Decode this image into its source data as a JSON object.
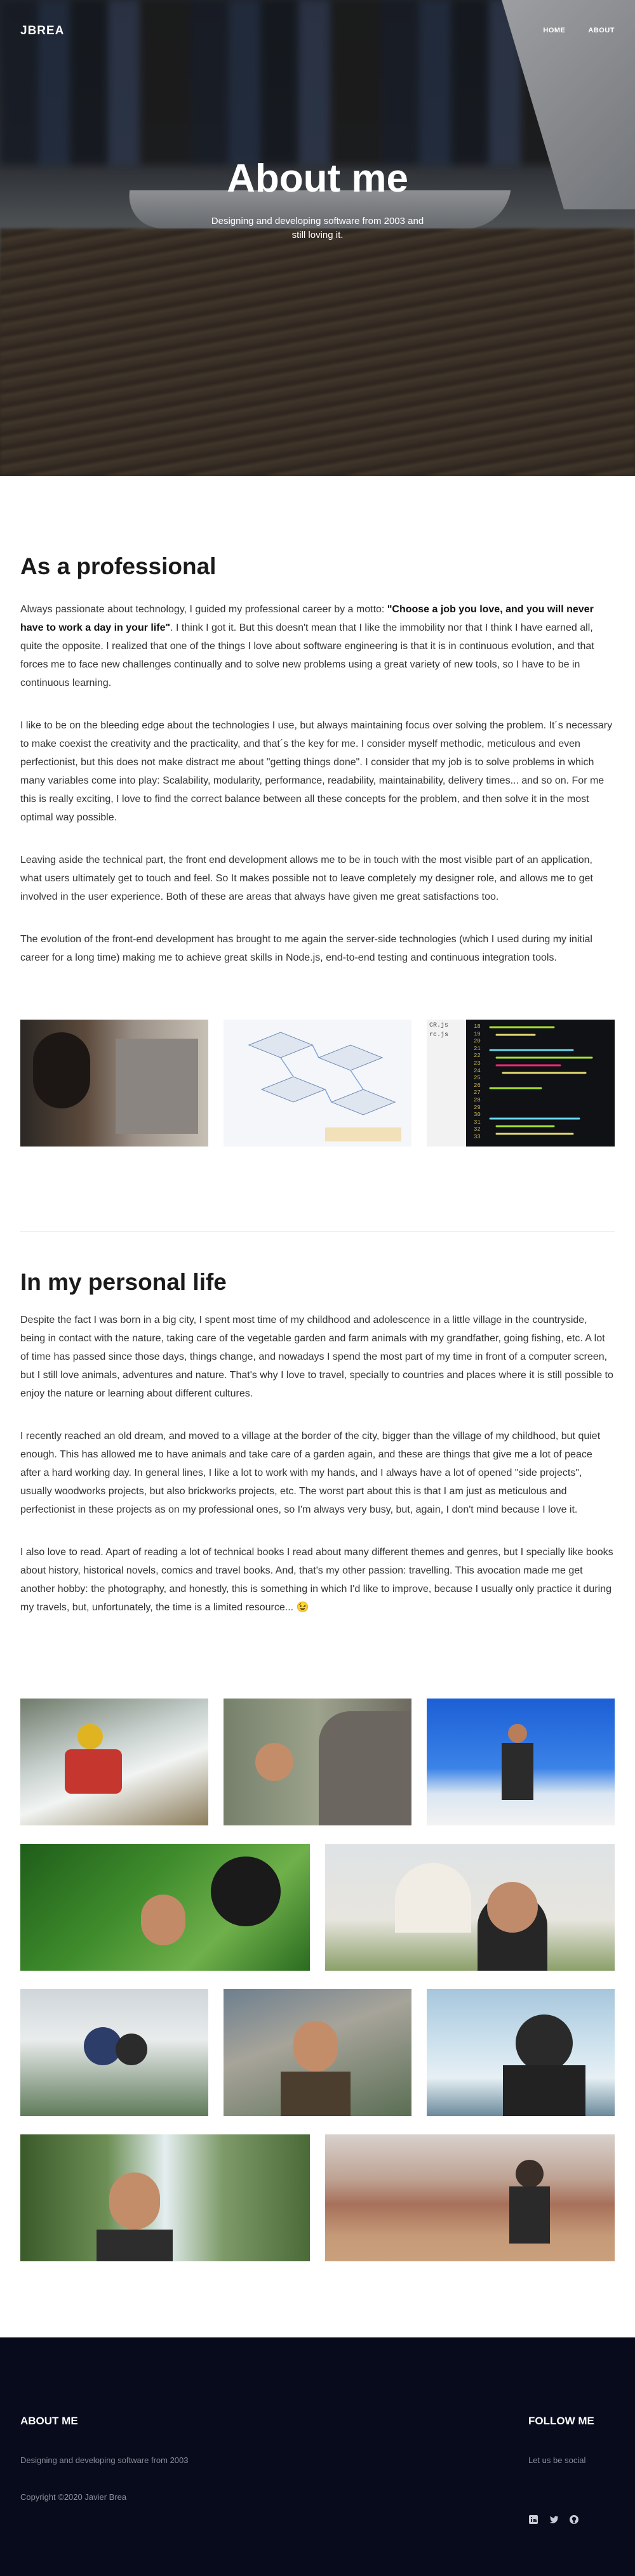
{
  "brand": "JBREA",
  "nav": {
    "items": [
      "HOME",
      "ABOUT"
    ]
  },
  "hero": {
    "title": "About me",
    "subtitle": "Designing and developing software from 2003 and still loving it."
  },
  "professional": {
    "heading": "As a professional",
    "p1_start": "Always passionate about technology, I guided my professional career by a motto: ",
    "p1_bold": "\"Choose a job you love, and you will never have to work a day in your life\"",
    "p1_end": ". I think I got it. But this doesn't mean that I like the immobility nor that I think I have earned all, quite the opposite. I realized that one of the things I love about software engineering is that it is in continuous evolution, and that forces me to face new challenges continually and to solve new problems using a great variety of new tools, so I have to be in continuous learning.",
    "p2": "I like to be on the bleeding edge about the technologies I use, but always maintaining focus over solving the problem. It´s necessary to make coexist the creativity and the practicality, and that´s the key for me. I consider myself methodic, meticulous and even perfectionist, but this does not make distract me about \"getting things done\". I consider that my job is to solve problems in which many variables come into play: Scalability, modularity, performance, readability, maintainability, delivery times... and so on. For me this is really exciting, I love to find the correct balance between all these concepts for the problem, and then solve it in the most optimal way possible.",
    "p3": "Leaving aside the technical part, the front end development allows me to be in touch with the most visible part of an application, what users ultimately get to touch and feel. So It makes possible not to leave completely my designer role, and allows me to get involved in the user experience. Both of these are areas that always have given me great satisfactions too.",
    "p4": "The evolution of the front-end development has brought to me again the server-side technologies (which I used during my initial career for a long time) making me to achieve great skills in Node.js, end-to-end testing and continuous integration tools."
  },
  "personal": {
    "heading": "In my personal life",
    "p1": "Despite the fact I was born in a big city, I spent most time of my childhood and adolescence in a little village in the countryside, being in contact with the nature, taking care of the vegetable garden and farm animals with my grandfather, going fishing, etc. A lot of time has passed since those days, things change, and nowadays I spend the most part of my time in front of a computer screen, but I still love animals, adventures and nature. That's why I love to travel, specially to countries and places where it is still possible to enjoy the nature or learning about different cultures.",
    "p2": "I recently reached an old dream, and moved to a village at the border of the city, bigger than the village of my childhood, but quiet enough. This has allowed me to have animals and take care of a garden again, and these are things that give me a lot of peace after a hard working day. In general lines, I like a lot to work with my hands, and I always have a lot of opened \"side projects\", usually woodworks projects, but also brickworks projects, etc. The worst part about this is that I am just as meticulous and perfectionist in these projects as on my professional ones, so I'm always very busy, but, again, I don't mind because I love it.",
    "p3": "I also love to read. Apart of reading a lot of technical books I read about many different themes and genres, but I specially like books about history, historical novels, comics and travel books. And, that's my other passion: travelling. This avocation made me get another hobby: the photography, and honestly, this is something in which I'd like to improve, because I usually only practice it during my travels, but, unfortunately, the time is a limited resource... 😉"
  },
  "code_lines": {
    "files": [
      "CR.js",
      "rc.js"
    ],
    "numbers": [
      "18",
      "19",
      "20",
      "21",
      "22",
      "23",
      "24",
      "25",
      "26",
      "27",
      "28",
      "29",
      "30",
      "31",
      "32",
      "33"
    ]
  },
  "footer": {
    "about_title": "ABOUT ME",
    "about_text": "Designing and developing software from 2003",
    "copyright": "Copyright ©2020 Javier Brea",
    "follow_title": "FOLLOW ME",
    "follow_text": "Let us be social"
  },
  "colors": {
    "footer_bg": "#070b1b",
    "accent": "#3b82f6"
  },
  "icons": [
    "linkedin-icon",
    "twitter-icon",
    "github-icon"
  ]
}
